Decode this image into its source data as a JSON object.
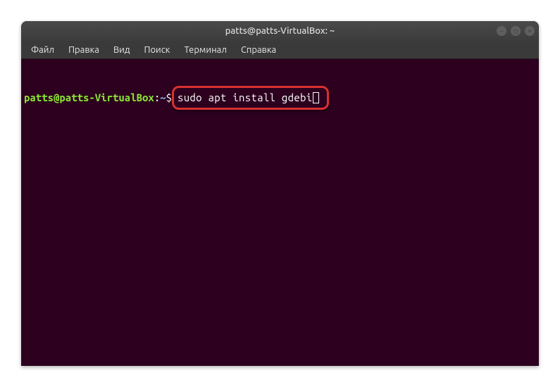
{
  "window": {
    "title": "patts@patts-VirtualBox: ~"
  },
  "menu": {
    "items": [
      "Файл",
      "Правка",
      "Вид",
      "Поиск",
      "Терминал",
      "Справка"
    ]
  },
  "terminal": {
    "prompt_userhost": "patts@patts-VirtualBox",
    "prompt_sep": ":",
    "prompt_path": "~",
    "prompt_symbol": "$",
    "command": "sudo apt install gdebi"
  },
  "controls": {
    "minimize": "–",
    "maximize": "□",
    "close": "×"
  }
}
